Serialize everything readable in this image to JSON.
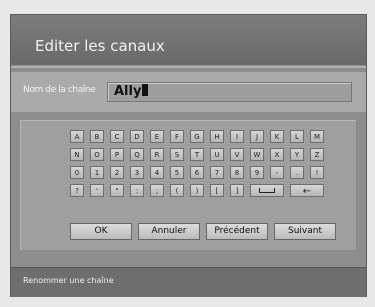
{
  "dialog": {
    "title": "Editer les canaux",
    "name_label": "Nom de la chaîne",
    "name_value": "Ally",
    "status": "Renommer une chaîne"
  },
  "keyboard": {
    "rows": [
      [
        "A",
        "B",
        "C",
        "D",
        "E",
        "F",
        "G",
        "H",
        "I",
        "J",
        "K",
        "L",
        "M"
      ],
      [
        "N",
        "O",
        "P",
        "Q",
        "R",
        "S",
        "T",
        "U",
        "V",
        "W",
        "X",
        "Y",
        "Z"
      ],
      [
        "0",
        "1",
        "2",
        "3",
        "4",
        "5",
        "6",
        "7",
        "8",
        "9",
        "-",
        ".",
        "!"
      ],
      [
        "?",
        "'",
        "\"",
        ":",
        ";",
        "(",
        ")",
        "[",
        "]"
      ]
    ],
    "space_icon": "space-key-icon",
    "backspace_icon": "arrow-left-icon",
    "backspace_glyph": "←"
  },
  "buttons": {
    "ok": "OK",
    "cancel": "Annuler",
    "previous": "Précédent",
    "next": "Suivant"
  }
}
